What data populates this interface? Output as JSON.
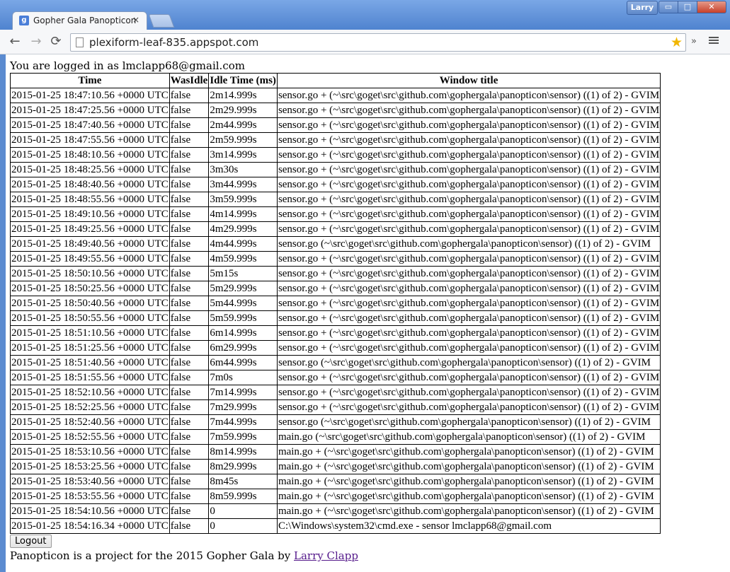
{
  "browser": {
    "tab_title": "Gopher Gala Panopticon",
    "tab_close": "×",
    "user_name": "Larry",
    "url": "plexiform-leaf-835.appspot.com",
    "star_icon": "★",
    "extensions_chevron": "»",
    "minimize_symbol": "▭",
    "maximize_symbol": "□",
    "close_symbol": "✕",
    "back_icon": "←",
    "forward_icon": "→",
    "reload_icon": "⟳"
  },
  "page": {
    "logged_in_text": "You are logged in as lmclapp68@gmail.com",
    "columns": [
      "Time",
      "WasIdle",
      "Idle Time (ms)",
      "Window title"
    ],
    "rows": [
      [
        "2015-01-25 18:47:10.56 +0000 UTC",
        "false",
        "2m14.999s",
        "sensor.go + (~\\src\\goget\\src\\github.com\\gophergala\\panopticon\\sensor) ((1) of 2) - GVIM"
      ],
      [
        "2015-01-25 18:47:25.56 +0000 UTC",
        "false",
        "2m29.999s",
        "sensor.go + (~\\src\\goget\\src\\github.com\\gophergala\\panopticon\\sensor) ((1) of 2) - GVIM"
      ],
      [
        "2015-01-25 18:47:40.56 +0000 UTC",
        "false",
        "2m44.999s",
        "sensor.go + (~\\src\\goget\\src\\github.com\\gophergala\\panopticon\\sensor) ((1) of 2) - GVIM"
      ],
      [
        "2015-01-25 18:47:55.56 +0000 UTC",
        "false",
        "2m59.999s",
        "sensor.go + (~\\src\\goget\\src\\github.com\\gophergala\\panopticon\\sensor) ((1) of 2) - GVIM"
      ],
      [
        "2015-01-25 18:48:10.56 +0000 UTC",
        "false",
        "3m14.999s",
        "sensor.go + (~\\src\\goget\\src\\github.com\\gophergala\\panopticon\\sensor) ((1) of 2) - GVIM"
      ],
      [
        "2015-01-25 18:48:25.56 +0000 UTC",
        "false",
        "3m30s",
        "sensor.go + (~\\src\\goget\\src\\github.com\\gophergala\\panopticon\\sensor) ((1) of 2) - GVIM"
      ],
      [
        "2015-01-25 18:48:40.56 +0000 UTC",
        "false",
        "3m44.999s",
        "sensor.go + (~\\src\\goget\\src\\github.com\\gophergala\\panopticon\\sensor) ((1) of 2) - GVIM"
      ],
      [
        "2015-01-25 18:48:55.56 +0000 UTC",
        "false",
        "3m59.999s",
        "sensor.go + (~\\src\\goget\\src\\github.com\\gophergala\\panopticon\\sensor) ((1) of 2) - GVIM"
      ],
      [
        "2015-01-25 18:49:10.56 +0000 UTC",
        "false",
        "4m14.999s",
        "sensor.go + (~\\src\\goget\\src\\github.com\\gophergala\\panopticon\\sensor) ((1) of 2) - GVIM"
      ],
      [
        "2015-01-25 18:49:25.56 +0000 UTC",
        "false",
        "4m29.999s",
        "sensor.go + (~\\src\\goget\\src\\github.com\\gophergala\\panopticon\\sensor) ((1) of 2) - GVIM"
      ],
      [
        "2015-01-25 18:49:40.56 +0000 UTC",
        "false",
        "4m44.999s",
        "sensor.go (~\\src\\goget\\src\\github.com\\gophergala\\panopticon\\sensor) ((1) of 2) - GVIM"
      ],
      [
        "2015-01-25 18:49:55.56 +0000 UTC",
        "false",
        "4m59.999s",
        "sensor.go + (~\\src\\goget\\src\\github.com\\gophergala\\panopticon\\sensor) ((1) of 2) - GVIM"
      ],
      [
        "2015-01-25 18:50:10.56 +0000 UTC",
        "false",
        "5m15s",
        "sensor.go + (~\\src\\goget\\src\\github.com\\gophergala\\panopticon\\sensor) ((1) of 2) - GVIM"
      ],
      [
        "2015-01-25 18:50:25.56 +0000 UTC",
        "false",
        "5m29.999s",
        "sensor.go + (~\\src\\goget\\src\\github.com\\gophergala\\panopticon\\sensor) ((1) of 2) - GVIM"
      ],
      [
        "2015-01-25 18:50:40.56 +0000 UTC",
        "false",
        "5m44.999s",
        "sensor.go + (~\\src\\goget\\src\\github.com\\gophergala\\panopticon\\sensor) ((1) of 2) - GVIM"
      ],
      [
        "2015-01-25 18:50:55.56 +0000 UTC",
        "false",
        "5m59.999s",
        "sensor.go + (~\\src\\goget\\src\\github.com\\gophergala\\panopticon\\sensor) ((1) of 2) - GVIM"
      ],
      [
        "2015-01-25 18:51:10.56 +0000 UTC",
        "false",
        "6m14.999s",
        "sensor.go + (~\\src\\goget\\src\\github.com\\gophergala\\panopticon\\sensor) ((1) of 2) - GVIM"
      ],
      [
        "2015-01-25 18:51:25.56 +0000 UTC",
        "false",
        "6m29.999s",
        "sensor.go + (~\\src\\goget\\src\\github.com\\gophergala\\panopticon\\sensor) ((1) of 2) - GVIM"
      ],
      [
        "2015-01-25 18:51:40.56 +0000 UTC",
        "false",
        "6m44.999s",
        "sensor.go (~\\src\\goget\\src\\github.com\\gophergala\\panopticon\\sensor) ((1) of 2) - GVIM"
      ],
      [
        "2015-01-25 18:51:55.56 +0000 UTC",
        "false",
        "7m0s",
        "sensor.go + (~\\src\\goget\\src\\github.com\\gophergala\\panopticon\\sensor) ((1) of 2) - GVIM"
      ],
      [
        "2015-01-25 18:52:10.56 +0000 UTC",
        "false",
        "7m14.999s",
        "sensor.go + (~\\src\\goget\\src\\github.com\\gophergala\\panopticon\\sensor) ((1) of 2) - GVIM"
      ],
      [
        "2015-01-25 18:52:25.56 +0000 UTC",
        "false",
        "7m29.999s",
        "sensor.go + (~\\src\\goget\\src\\github.com\\gophergala\\panopticon\\sensor) ((1) of 2) - GVIM"
      ],
      [
        "2015-01-25 18:52:40.56 +0000 UTC",
        "false",
        "7m44.999s",
        "sensor.go (~\\src\\goget\\src\\github.com\\gophergala\\panopticon\\sensor) ((1) of 2) - GVIM"
      ],
      [
        "2015-01-25 18:52:55.56 +0000 UTC",
        "false",
        "7m59.999s",
        "main.go (~\\src\\goget\\src\\github.com\\gophergala\\panopticon\\sensor) ((1) of 2) - GVIM"
      ],
      [
        "2015-01-25 18:53:10.56 +0000 UTC",
        "false",
        "8m14.999s",
        "main.go + (~\\src\\goget\\src\\github.com\\gophergala\\panopticon\\sensor) ((1) of 2) - GVIM"
      ],
      [
        "2015-01-25 18:53:25.56 +0000 UTC",
        "false",
        "8m29.999s",
        "main.go + (~\\src\\goget\\src\\github.com\\gophergala\\panopticon\\sensor) ((1) of 2) - GVIM"
      ],
      [
        "2015-01-25 18:53:40.56 +0000 UTC",
        "false",
        "8m45s",
        "main.go + (~\\src\\goget\\src\\github.com\\gophergala\\panopticon\\sensor) ((1) of 2) - GVIM"
      ],
      [
        "2015-01-25 18:53:55.56 +0000 UTC",
        "false",
        "8m59.999s",
        "main.go + (~\\src\\goget\\src\\github.com\\gophergala\\panopticon\\sensor) ((1) of 2) - GVIM"
      ],
      [
        "2015-01-25 18:54:10.56 +0000 UTC",
        "false",
        "0",
        "main.go + (~\\src\\goget\\src\\github.com\\gophergala\\panopticon\\sensor) ((1) of 2) - GVIM"
      ],
      [
        "2015-01-25 18:54:16.34 +0000 UTC",
        "false",
        "0",
        "C:\\Windows\\system32\\cmd.exe - sensor lmclapp68@gmail.com"
      ]
    ],
    "logout_label": "Logout",
    "footer_text": "Panopticon is a project for the 2015 Gopher Gala by ",
    "footer_link": "Larry Clapp"
  }
}
